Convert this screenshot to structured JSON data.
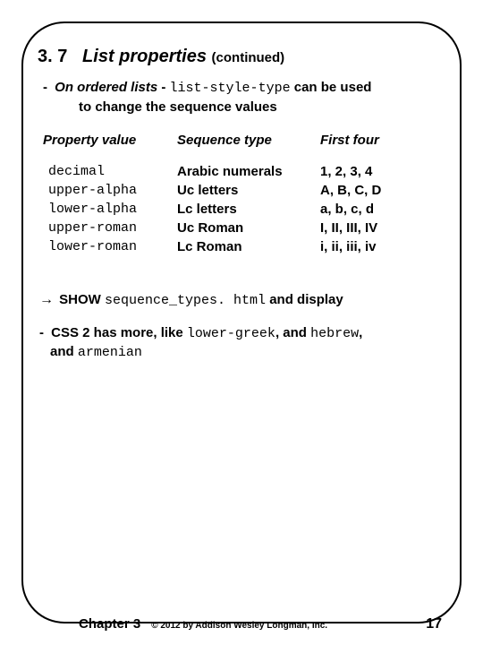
{
  "heading": {
    "number": "3. 7",
    "title": "List properties",
    "cont": "(continued)"
  },
  "bullet1": {
    "dash": "-",
    "lead": "On ordered lists",
    "sep": " - ",
    "code": "list-style-type",
    "tail": " can be used",
    "line2": "to change the sequence values"
  },
  "headers": {
    "c1": "Property value",
    "c2": "Sequence type",
    "c3": "First four"
  },
  "rows": [
    {
      "c1": "decimal",
      "c2": "Arabic numerals",
      "c3": "1, 2, 3, 4"
    },
    {
      "c1": "upper-alpha",
      "c2": "Uc letters",
      "c3": " A, B, C, D"
    },
    {
      "c1": "lower-alpha",
      "c2": "Lc letters",
      "c3": " a, b, c, d"
    },
    {
      "c1": "upper-roman",
      "c2": "Uc Roman",
      "c3": " I, II, III, IV"
    },
    {
      "c1": "lower-roman",
      "c2": "Lc Roman",
      "c3": "  i, ii, iii, iv"
    }
  ],
  "show": {
    "arrow": "→",
    "lead": " SHOW ",
    "code": "sequence_types. html",
    "tail": " and display"
  },
  "note": {
    "dash": "-",
    "lead": " CSS 2 has more, like ",
    "code1": "lower-greek",
    "mid": ", and ",
    "code2": "hebrew",
    "tail": ",",
    "line2a": "and ",
    "code3": "armenian"
  },
  "footer": {
    "chapter": "Chapter 3",
    "copyright": "© 2012 by Addison Wesley Longman, Inc.",
    "page": "17"
  }
}
